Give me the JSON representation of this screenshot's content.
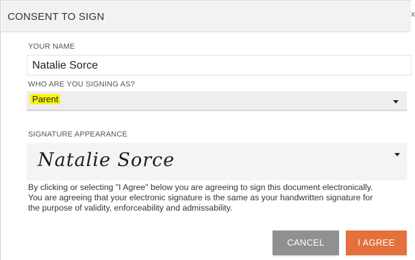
{
  "dialog": {
    "title": "CONSENT TO SIGN",
    "close_label": "x"
  },
  "name_field": {
    "label": "YOUR NAME",
    "value": "Natalie Sorce"
  },
  "signing_as": {
    "label": "WHO ARE YOU SIGNING AS?",
    "selected": "Parent",
    "highlight_color": "#f7f30e"
  },
  "signature": {
    "label": "SIGNATURE APPEARANCE",
    "value": "Natalie Sorce"
  },
  "disclaimer": "By clicking or selecting \"I Agree\" below you are agreeing to sign this document electronically. You are agreeing that your electronic signature is the same as your handwritten signature for the purpose of validity, enforceability and admissability.",
  "buttons": {
    "cancel": "CANCEL",
    "agree": "I AGREE"
  },
  "colors": {
    "agree_button": "#e4703e",
    "cancel_button": "#909090"
  }
}
